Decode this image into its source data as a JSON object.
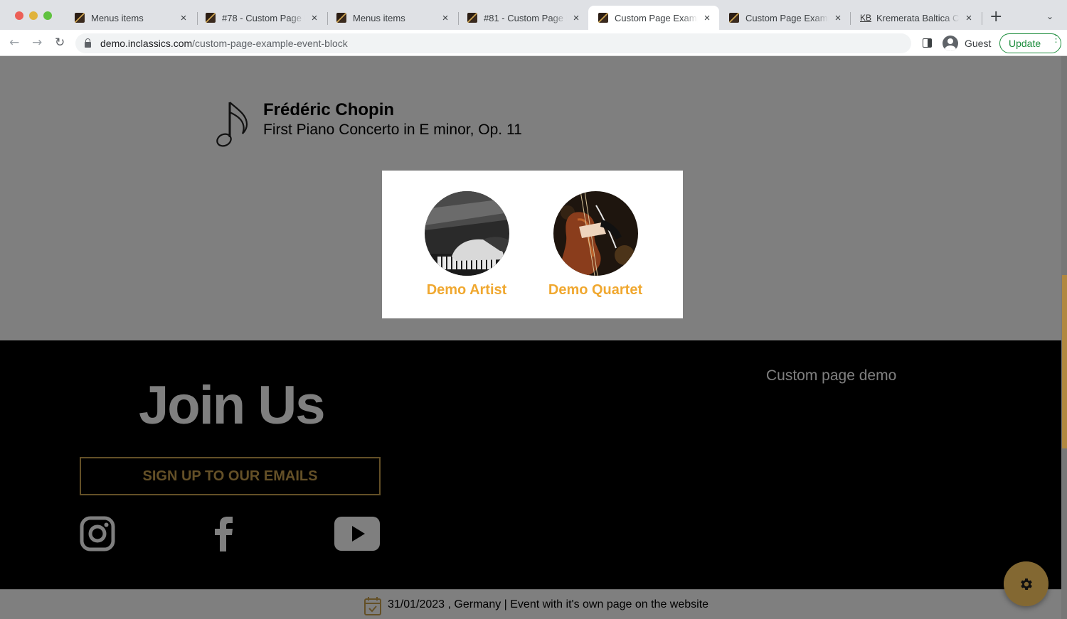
{
  "browser": {
    "tabs": [
      {
        "title": "Menus items",
        "favicon": "site-favicon",
        "active": false
      },
      {
        "title": "#78 - Custom Page E",
        "favicon": "site-favicon",
        "active": false
      },
      {
        "title": "Menus items",
        "favicon": "site-favicon",
        "active": false
      },
      {
        "title": "#81 - Custom Page E",
        "favicon": "site-favicon",
        "active": false
      },
      {
        "title": "Custom Page Exampl",
        "favicon": "site-favicon",
        "active": true
      },
      {
        "title": "Custom Page Exampl",
        "favicon": "site-favicon",
        "active": false
      },
      {
        "title": "Kremerata Baltica Ch",
        "favicon": "KB",
        "active": false
      }
    ],
    "new_tab_label": "+",
    "url_host": "demo.inclassics.com",
    "url_path": "/custom-page-example-event-block",
    "profile_label": "Guest",
    "update_label": "Update"
  },
  "program": {
    "composer": "Frédéric Chopin",
    "piece": "First Piano Concerto in E minor, Op. 11"
  },
  "popup": {
    "artists": [
      {
        "name": "Demo Artist",
        "image": "pianist-hands-photo"
      },
      {
        "name": "Demo Quartet",
        "image": "cellist-photo"
      }
    ]
  },
  "footer": {
    "heading": "Join Us",
    "signup_label": "SIGN UP TO OUR EMAILS",
    "social": [
      "instagram-icon",
      "facebook-icon",
      "youtube-icon"
    ],
    "link": "Custom page demo"
  },
  "event_bar": {
    "text": "31/01/2023 , Germany | Event with it's own page on the website"
  },
  "colors": {
    "accent_gold": "#c9a04e",
    "artist_name": "#f0a830",
    "footer_bg": "#000000"
  }
}
